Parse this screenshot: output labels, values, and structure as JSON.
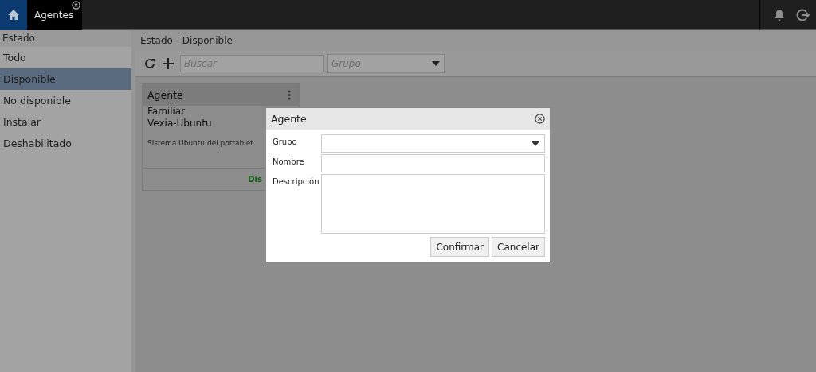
{
  "top_bar": {
    "tabs": [
      {
        "kind": "home",
        "selected": true
      },
      {
        "kind": "label",
        "label": "Agentes",
        "selected": false,
        "closable": true
      }
    ]
  },
  "sidebar": {
    "title": "Estado",
    "items": [
      {
        "label": "Todo",
        "selected": false
      },
      {
        "label": "Disponible",
        "selected": true
      },
      {
        "label": "No disponible",
        "selected": false
      },
      {
        "label": "Instalar",
        "selected": false
      },
      {
        "label": "Deshabilitado",
        "selected": false
      }
    ]
  },
  "main": {
    "title": "Estado - Disponible",
    "search": {
      "placeholder": "Buscar"
    },
    "group_select": {
      "placeholder": "Grupo"
    },
    "card": {
      "title": "Agente",
      "group": "Familiar",
      "name": "Vexia-Ubuntu",
      "description": "Sistema Ubuntu del portablet",
      "status": "Dis"
    }
  },
  "dialog": {
    "title": "Agente",
    "fields": [
      {
        "kind": "select",
        "label": "Grupo"
      },
      {
        "kind": "text",
        "label": "Nombre"
      },
      {
        "kind": "textarea",
        "label": "Descripción"
      }
    ],
    "buttons": [
      "Confirmar",
      "Cancelar"
    ]
  }
}
